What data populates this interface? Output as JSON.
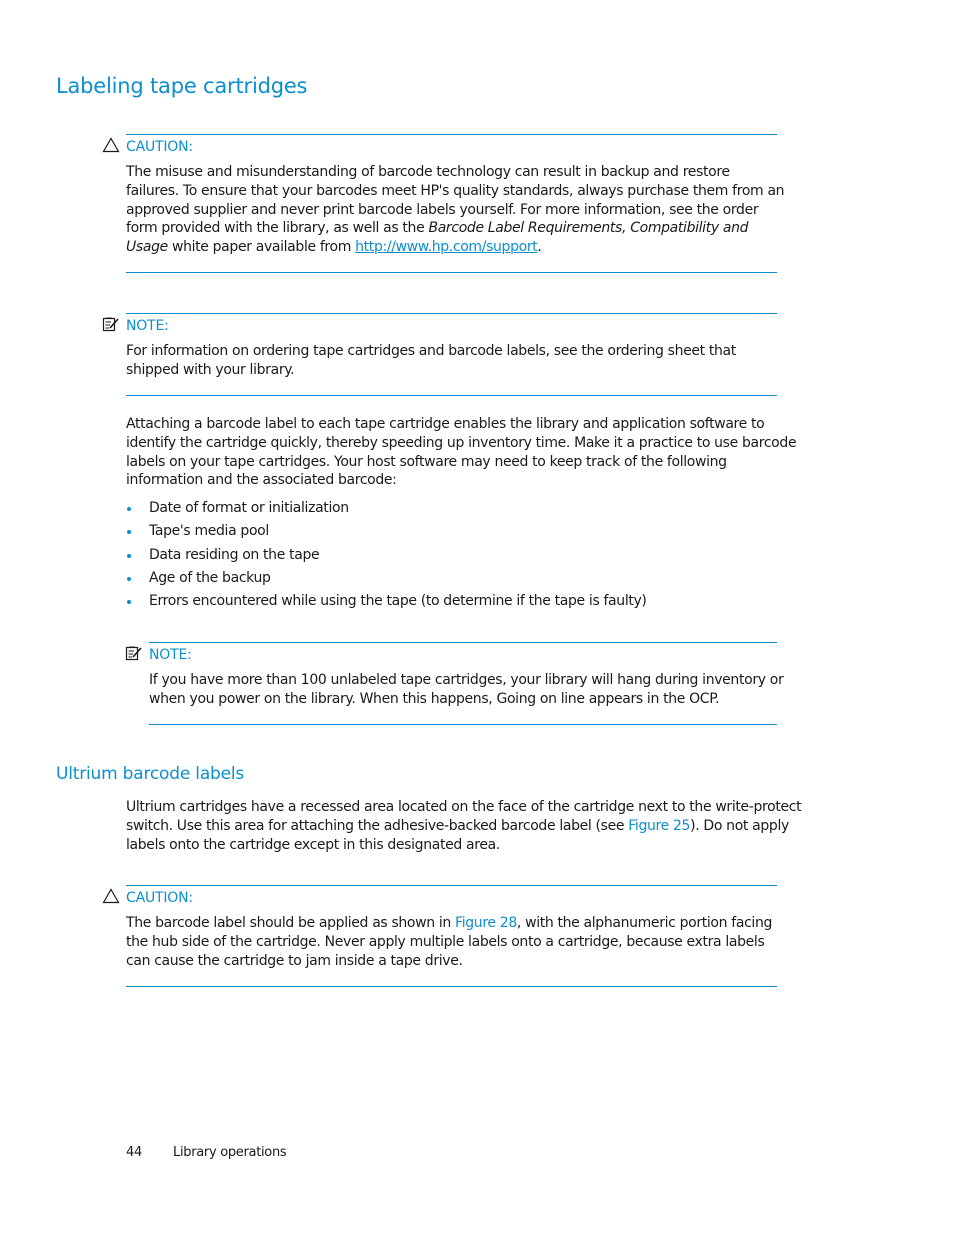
{
  "heading": "Labeling tape cartridges",
  "caution1": {
    "icon": "warning-triangle-icon",
    "label": "CAUTION:",
    "text_before_italic": "The misuse and misunderstanding of barcode technology can result in backup and restore failures. To ensure that your barcodes meet HP's quality standards, always purchase them from an approved supplier and never print barcode labels yourself. For more information, see the order form provided with the library, as well as the ",
    "italic": "Barcode Label Requirements, Compatibility and Usage",
    "text_after_italic": " white paper available from ",
    "link": "http://www.hp.com/support",
    "text_end": "."
  },
  "note1": {
    "icon": "note-pencil-icon",
    "label": "NOTE:",
    "text": "For information on ordering tape cartridges and barcode labels, see the ordering sheet that shipped with your library."
  },
  "intro_paragraph": "Attaching a barcode label to each tape cartridge enables the library and application software to identify the cartridge quickly, thereby speeding up inventory time. Make it a practice to use barcode labels on your tape cartridges. Your host software may need to keep track of the following information and the associated barcode:",
  "bullets": [
    "Date of format or initialization",
    "Tape's media pool",
    "Data residing on the tape",
    "Age of the backup",
    "Errors encountered while using the tape (to determine if the tape is faulty)"
  ],
  "note2": {
    "icon": "note-pencil-icon",
    "label": "NOTE:",
    "text": "If you have more than 100 unlabeled tape cartridges, your library will hang during inventory or when you power on the library. When this happens, Going on line appears in the OCP."
  },
  "subheading": "Ultrium barcode labels",
  "ultrium_paragraph": {
    "before": "Ultrium cartridges have a recessed area located on the face of the cartridge next to the write-protect switch. Use this area for attaching the adhesive-backed barcode label (see ",
    "xref": "Figure 25",
    "after": "). Do not apply labels onto the cartridge except in this designated area."
  },
  "caution2": {
    "icon": "warning-triangle-icon",
    "label": "CAUTION:",
    "before": "The barcode label should be applied as shown in ",
    "xref": "Figure 28",
    "after": ", with the alphanumeric portion facing the hub side of the cartridge. Never apply multiple labels onto a cartridge, because extra labels can cause the cartridge to jam inside a tape drive."
  },
  "footer": {
    "page_number": "44",
    "section": "Library operations"
  },
  "colors": {
    "accent": "#0b8fcf",
    "text": "#1a1a1a"
  }
}
